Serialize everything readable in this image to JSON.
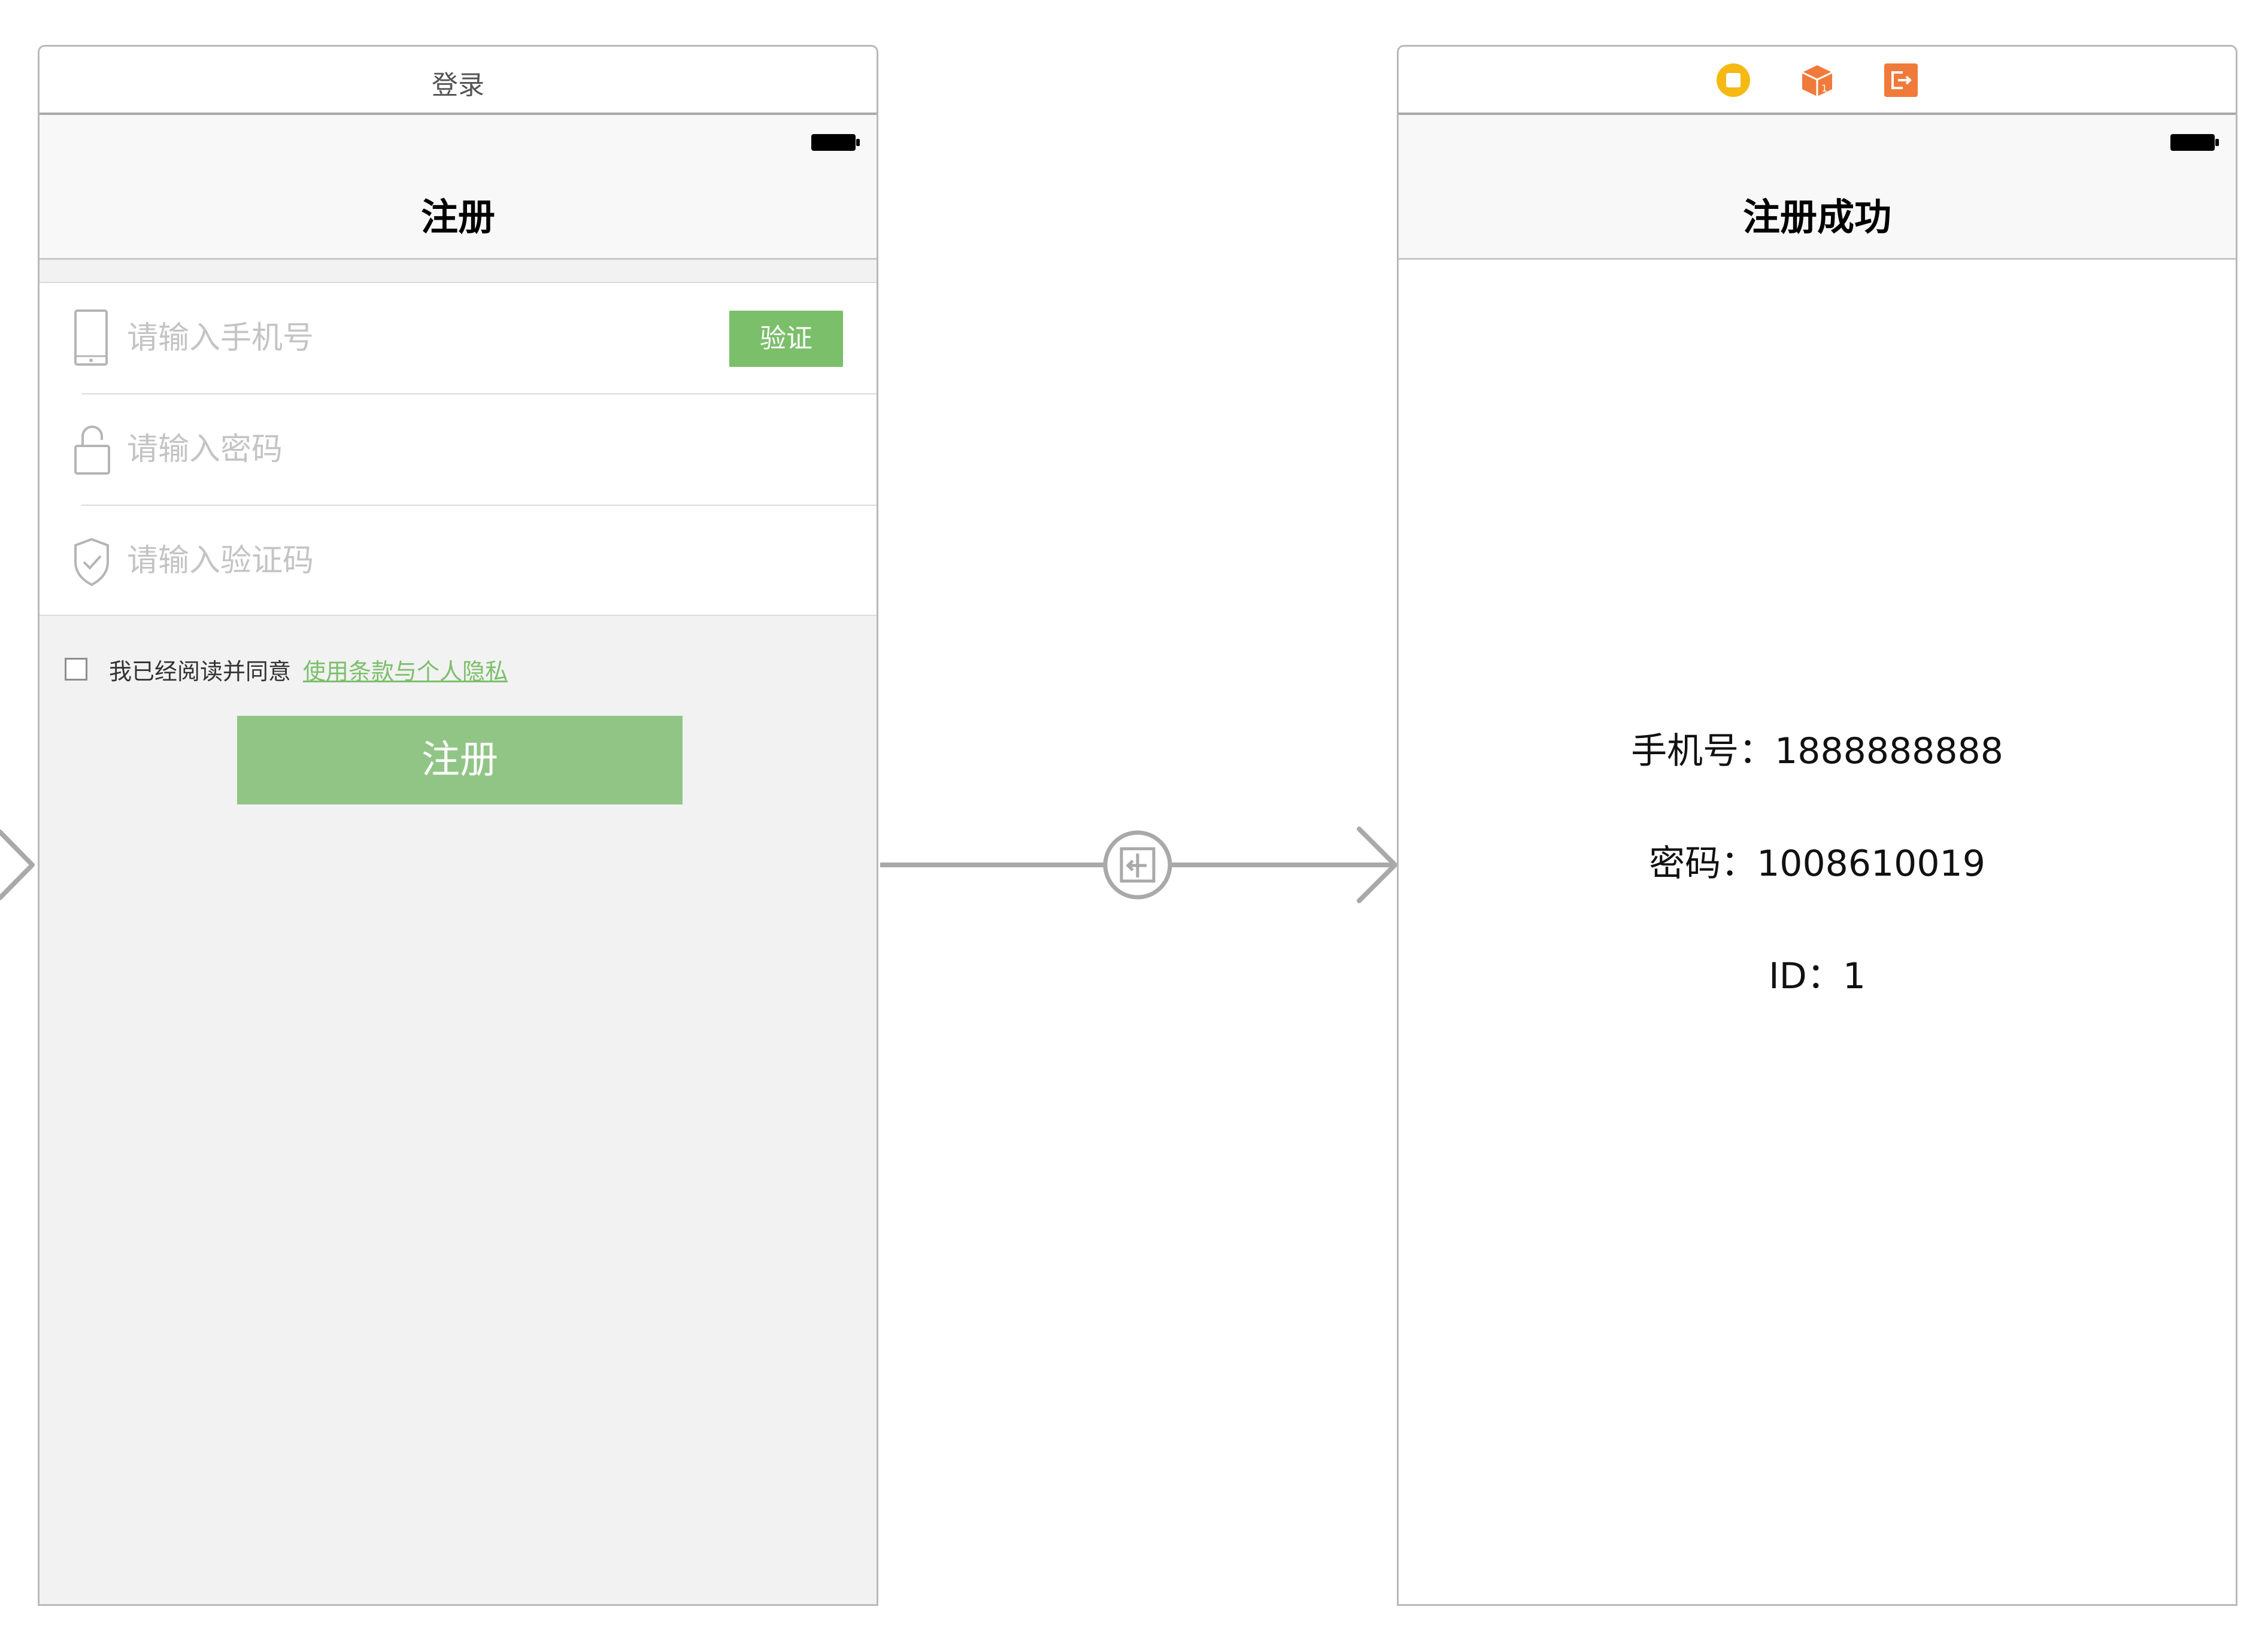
{
  "left_scene": {
    "title": "登录",
    "nav_title": "注册",
    "phone_placeholder": "请输入手机号",
    "verify_label": "验证",
    "password_placeholder": "请输入密码",
    "code_placeholder": "请输入验证码",
    "agree_text": "我已经阅读并同意",
    "terms_link": "使用条款与个人隐私",
    "register_label": "注册"
  },
  "right_scene": {
    "dock_icons": [
      "view-controller-icon",
      "first-responder-icon",
      "exit-icon"
    ],
    "nav_title": "注册成功",
    "phone_line": "手机号：1888888888",
    "password_line": "密码：1008610019",
    "id_line": "ID：1"
  },
  "icons": {
    "phone": "phone-icon",
    "lock": "lock-icon",
    "shield": "shield-check-icon",
    "segue": "segue-icon"
  },
  "colors": {
    "accent_green": "#7bbf6b",
    "button_green": "#91c586",
    "dock_yellow": "#f5b912",
    "dock_orange": "#f07a3a",
    "segue_gray": "#a9a9a9"
  }
}
